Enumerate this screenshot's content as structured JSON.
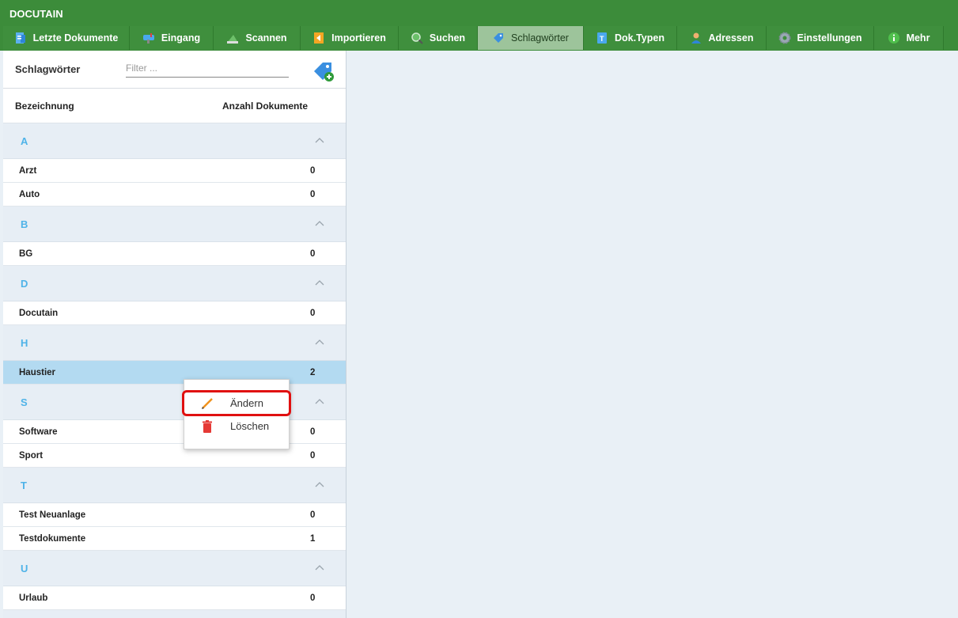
{
  "app": {
    "title": "DOCUTAIN"
  },
  "toolbar": {
    "items": [
      {
        "label": "Letzte Dokumente",
        "icon": "document-icon",
        "active": false
      },
      {
        "label": "Eingang",
        "icon": "mailbox-icon",
        "active": false
      },
      {
        "label": "Scannen",
        "icon": "scanner-icon",
        "active": false
      },
      {
        "label": "Importieren",
        "icon": "import-icon",
        "active": false
      },
      {
        "label": "Suchen",
        "icon": "search-icon",
        "active": false
      },
      {
        "label": "Schlagwörter",
        "icon": "tag-icon",
        "active": true
      },
      {
        "label": "Dok.Typen",
        "icon": "doctype-icon",
        "active": false
      },
      {
        "label": "Adressen",
        "icon": "person-icon",
        "active": false
      },
      {
        "label": "Einstellungen",
        "icon": "gear-icon",
        "active": false
      },
      {
        "label": "Mehr",
        "icon": "info-icon",
        "active": false
      }
    ]
  },
  "panel": {
    "title": "Schlagwörter",
    "filter_placeholder": "Filter ...",
    "columns": {
      "name": "Bezeichnung",
      "count": "Anzahl Dokumente"
    },
    "groups": [
      {
        "letter": "A",
        "rows": [
          {
            "name": "Arzt",
            "count": "0"
          },
          {
            "name": "Auto",
            "count": "0"
          }
        ]
      },
      {
        "letter": "B",
        "rows": [
          {
            "name": "BG",
            "count": "0"
          }
        ]
      },
      {
        "letter": "D",
        "rows": [
          {
            "name": "Docutain",
            "count": "0"
          }
        ]
      },
      {
        "letter": "H",
        "rows": [
          {
            "name": "Haustier",
            "count": "2",
            "selected": true
          }
        ]
      },
      {
        "letter": "S",
        "rows": [
          {
            "name": "Software",
            "count": "0"
          },
          {
            "name": "Sport",
            "count": "0"
          }
        ]
      },
      {
        "letter": "T",
        "rows": [
          {
            "name": "Test Neuanlage",
            "count": "0"
          },
          {
            "name": "Testdokumente",
            "count": "1"
          }
        ]
      },
      {
        "letter": "U",
        "rows": [
          {
            "name": "Urlaub",
            "count": "0"
          }
        ]
      }
    ]
  },
  "context_menu": {
    "edit_label": "Ändern",
    "delete_label": "Löschen"
  },
  "colors": {
    "header_green": "#3c8c3a",
    "active_tab": "#9dc49b",
    "letter_blue": "#4fb3e8",
    "selected_row": "#b3daf1",
    "highlight_red": "#e01010"
  }
}
